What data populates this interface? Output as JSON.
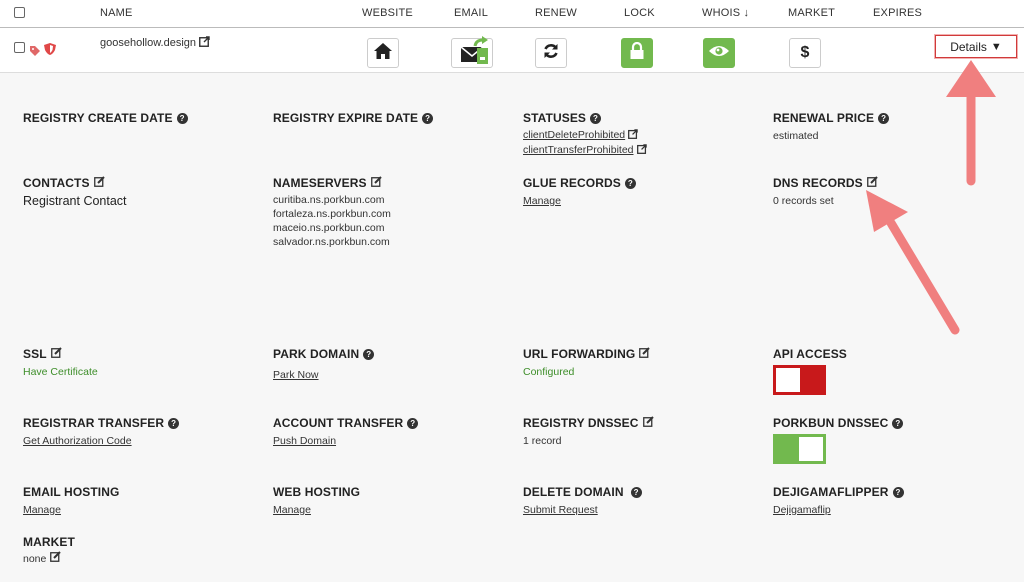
{
  "header": {
    "name": "NAME",
    "website": "WEBSITE",
    "email": "EMAIL",
    "renew": "RENEW",
    "lock": "LOCK",
    "whois": "WHOIS ↓",
    "market": "MARKET",
    "expires": "EXPIRES"
  },
  "row": {
    "domain": "goosehollow.design",
    "market_symbol": "$",
    "details_label": "Details",
    "details_arrow": "▼"
  },
  "fields": {
    "registry_create_date": {
      "label": "REGISTRY CREATE DATE"
    },
    "registry_expire_date": {
      "label": "REGISTRY EXPIRE DATE"
    },
    "statuses": {
      "label": "STATUSES",
      "values": [
        "clientDeleteProhibited",
        "clientTransferProhibited"
      ]
    },
    "renewal_price": {
      "label": "RENEWAL PRICE",
      "value": "estimated"
    },
    "contacts": {
      "label": "CONTACTS",
      "value": "Registrant Contact"
    },
    "nameservers": {
      "label": "NAMESERVERS",
      "values": [
        "curitiba.ns.porkbun.com",
        "fortaleza.ns.porkbun.com",
        "maceio.ns.porkbun.com",
        "salvador.ns.porkbun.com"
      ]
    },
    "glue_records": {
      "label": "GLUE RECORDS",
      "link": "Manage"
    },
    "dns_records": {
      "label": "DNS RECORDS",
      "value": "0 records set"
    },
    "ssl": {
      "label": "SSL",
      "value": "Have Certificate"
    },
    "park_domain": {
      "label": "PARK DOMAIN",
      "link": "Park Now"
    },
    "url_forwarding": {
      "label": "URL FORWARDING",
      "value": "Configured"
    },
    "api_access": {
      "label": "API ACCESS",
      "enabled": false
    },
    "registrar_transfer": {
      "label": "REGISTRAR TRANSFER",
      "link": "Get Authorization Code"
    },
    "account_transfer": {
      "label": "ACCOUNT TRANSFER",
      "link": "Push Domain"
    },
    "registry_dnssec": {
      "label": "REGISTRY DNSSEC",
      "value": "1 record"
    },
    "porkbun_dnssec": {
      "label": "PORKBUN DNSSEC",
      "enabled": true
    },
    "email_hosting": {
      "label": "EMAIL HOSTING",
      "link": "Manage"
    },
    "web_hosting": {
      "label": "WEB HOSTING",
      "link": "Manage"
    },
    "delete_domain": {
      "label": "DELETE DOMAIN",
      "link": "Submit Request"
    },
    "dejigamaflipper": {
      "label": "DEJIGAMAFLIPPER",
      "link": "Dejigamaflip"
    },
    "market": {
      "label": "MARKET",
      "value": "none"
    }
  },
  "colors": {
    "accent_green": "#72b94e",
    "toggle_red": "#c8191b",
    "annotation_arrow": "#f07f7f"
  }
}
